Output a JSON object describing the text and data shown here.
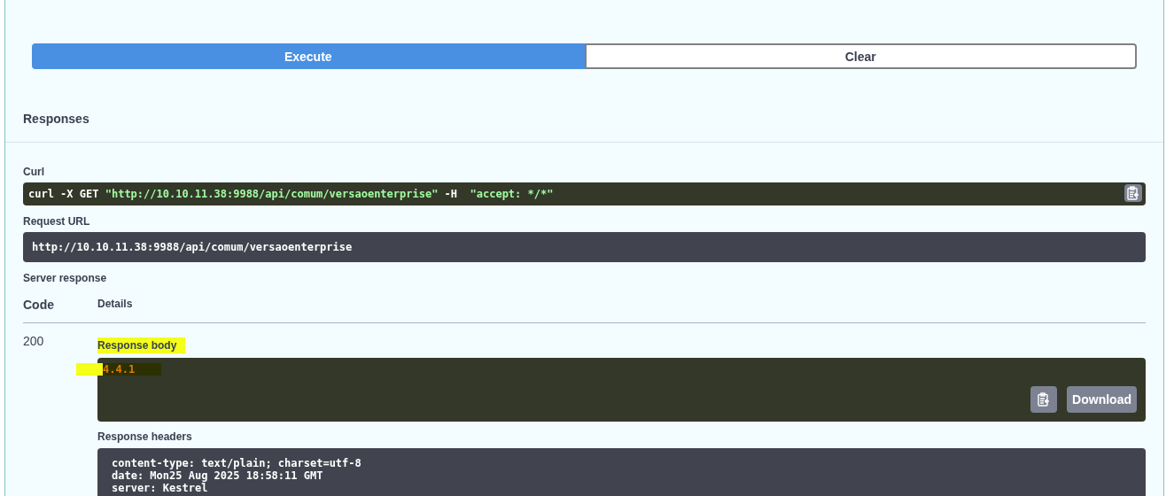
{
  "actions": [
    {
      "label": "Execute",
      "selected": true
    },
    {
      "label": "Clear",
      "selected": false
    }
  ],
  "responses": {
    "title": "Responses",
    "curl": {
      "label": "Curl",
      "parts": [
        {
          "kind": "plain",
          "text": "curl -X GET "
        },
        {
          "kind": "string",
          "text": "\"http://10.10.11.38:9988/api/comum/versaoenterprise\""
        },
        {
          "kind": "plain",
          "text": " -H  "
        },
        {
          "kind": "string",
          "text": "\"accept: */*\""
        }
      ]
    },
    "request_url": {
      "label": "Request URL",
      "value": "http://10.10.11.38:9988/api/comum/versaoenterprise"
    },
    "server_response": {
      "label": "Server response",
      "columns": [
        "Code",
        "Details"
      ],
      "code": "200",
      "body": {
        "label": "Response body",
        "value": "4.4.1",
        "highlighted": true,
        "download": "Download"
      },
      "headers": {
        "label": "Response headers",
        "lines": [
          "content-type: text/plain; charset=utf-8",
          "date: Mon25 Aug 2025 18:58:11 GMT",
          "server: Kestrel"
        ]
      }
    }
  }
}
